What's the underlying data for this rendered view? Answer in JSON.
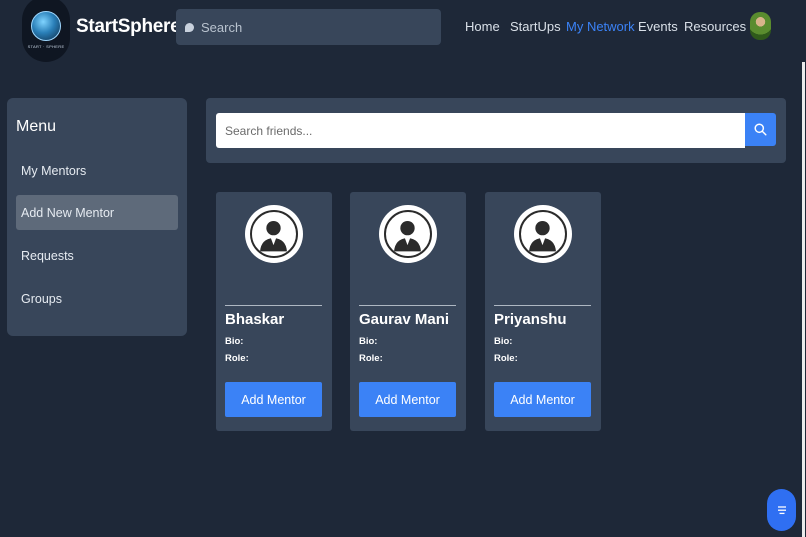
{
  "header": {
    "logo_text": "START · SPHERE",
    "brand": "StartSphere",
    "search_placeholder": "Search",
    "nav": [
      {
        "label": "Home",
        "active": false
      },
      {
        "label": "StartUps",
        "active": false
      },
      {
        "label": "My Network",
        "active": true
      },
      {
        "label": "Events",
        "active": false
      },
      {
        "label": "Resources",
        "active": false
      }
    ],
    "accent_color": "#3b82f6"
  },
  "sidebar": {
    "title": "Menu",
    "items": [
      {
        "label": "My Mentors",
        "active": false
      },
      {
        "label": "Add New Mentor",
        "active": true
      },
      {
        "label": "Requests",
        "active": false
      },
      {
        "label": "Groups",
        "active": false
      }
    ]
  },
  "friend_search": {
    "placeholder": "Search friends...",
    "button_icon": "search-icon"
  },
  "mentors": [
    {
      "name": "Bhaskar",
      "bio_label": "Bio:",
      "role_label": "Role:",
      "button": "Add Mentor"
    },
    {
      "name": "Gaurav Mani",
      "bio_label": "Bio:",
      "role_label": "Role:",
      "button": "Add Mentor"
    },
    {
      "name": "Priyanshu",
      "bio_label": "Bio:",
      "role_label": "Role:",
      "button": "Add Mentor"
    }
  ],
  "fab_icon": "menu-icon"
}
